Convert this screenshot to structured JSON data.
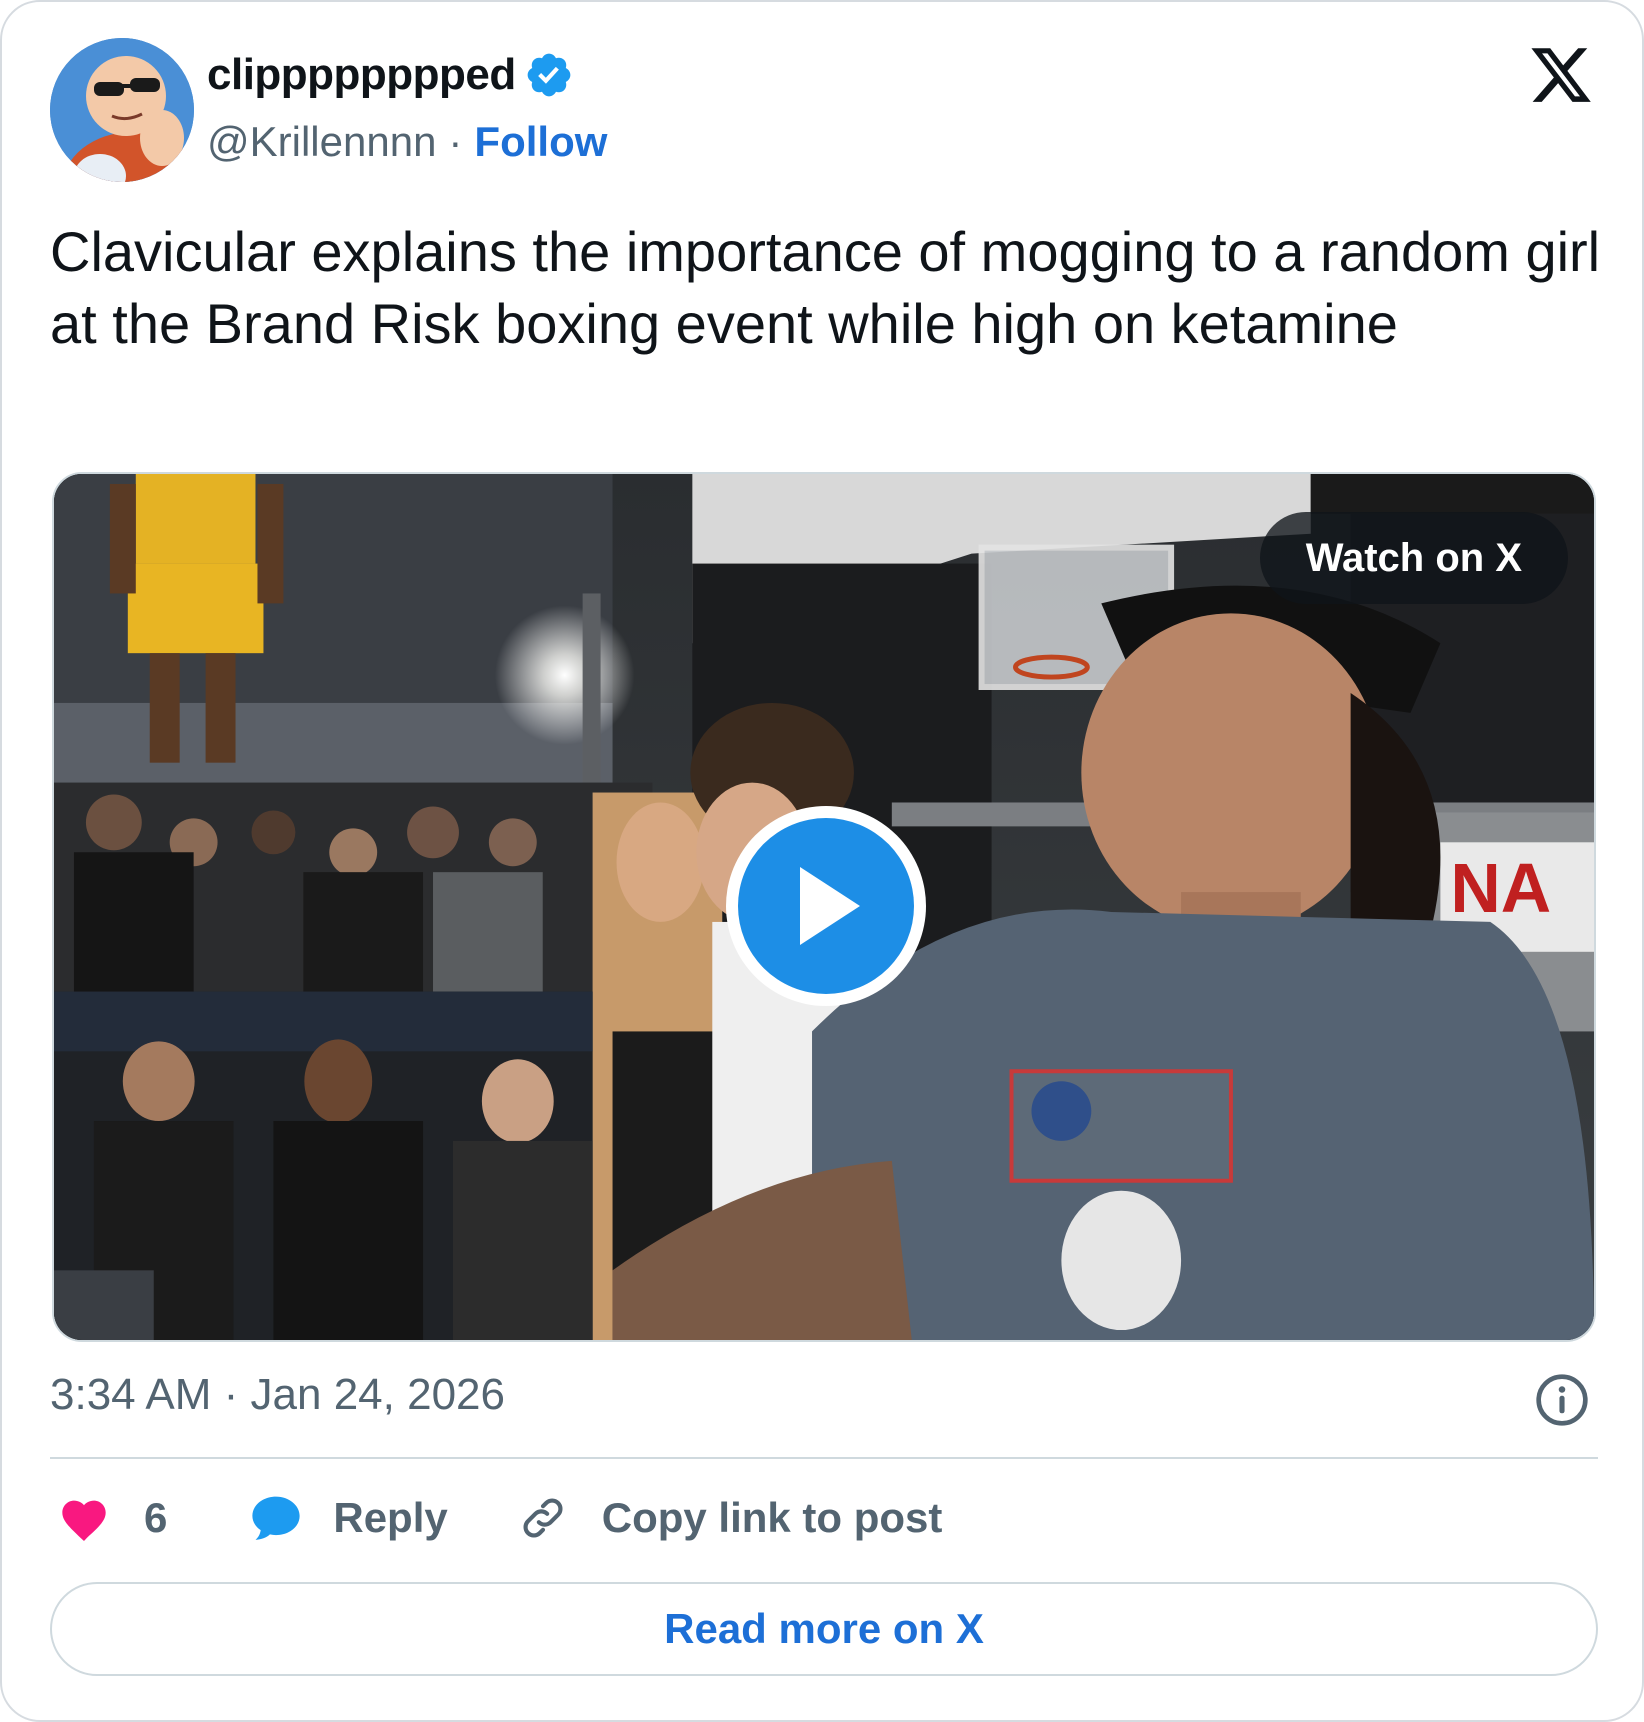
{
  "author": {
    "display_name": "clipppppppped",
    "handle": "@Krillennnn",
    "separator": "·",
    "follow_label": "Follow",
    "verified": true
  },
  "tweet": {
    "text": "Clavicular explains the importance of mogging to a random girl at the Brand Risk boxing event while high on ketamine"
  },
  "media": {
    "type": "video",
    "watch_label": "Watch on X",
    "play_icon": "play-icon"
  },
  "meta": {
    "timestamp": "3:34 AM · Jan 24, 2026"
  },
  "actions": {
    "like_count": "6",
    "reply_label": "Reply",
    "copy_label": "Copy link to post"
  },
  "footer": {
    "read_more_label": "Read more on X"
  },
  "colors": {
    "accent": "#1d6fd6",
    "like": "#f91880",
    "reply_icon": "#1d9bf0",
    "muted": "#536471",
    "border": "#cfd9de"
  }
}
